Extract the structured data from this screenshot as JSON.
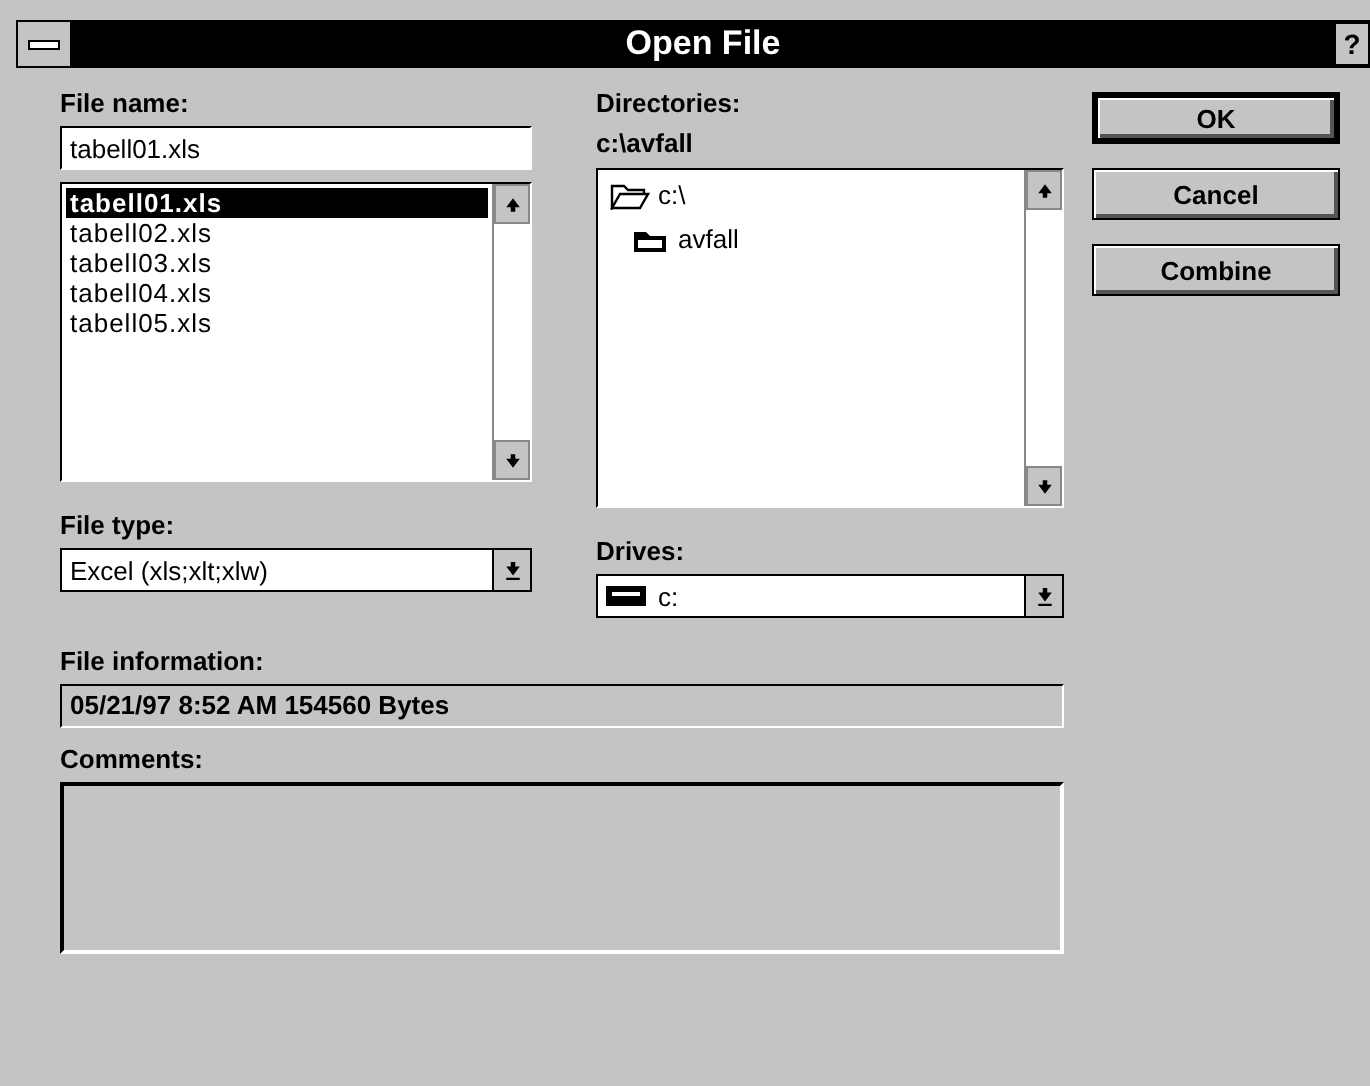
{
  "window": {
    "title": "Open File",
    "help": "?"
  },
  "file_name": {
    "label": "File name:",
    "value": "tabell01.xls"
  },
  "files": [
    {
      "name": "tabell01.xls",
      "selected": true
    },
    {
      "name": "tabell02.xls",
      "selected": false
    },
    {
      "name": "tabell03.xls",
      "selected": false
    },
    {
      "name": "tabell04.xls",
      "selected": false
    },
    {
      "name": "tabell05.xls",
      "selected": false
    }
  ],
  "directories": {
    "label": "Directories:",
    "path": "c:\\avfall",
    "items": [
      {
        "name": "c:\\",
        "kind": "open"
      },
      {
        "name": "avfall",
        "kind": "current"
      }
    ]
  },
  "file_type": {
    "label": "File type:",
    "value": "Excel (xls;xlt;xlw)"
  },
  "drives": {
    "label": "Drives:",
    "value": "c:"
  },
  "file_information": {
    "label": "File information:",
    "value": "05/21/97  8:52 AM  154560 Bytes"
  },
  "comments": {
    "label": "Comments:"
  },
  "buttons": [
    {
      "label": "OK",
      "default": true
    },
    {
      "label": "Cancel",
      "default": false
    },
    {
      "label": "Combine",
      "default": false
    }
  ]
}
